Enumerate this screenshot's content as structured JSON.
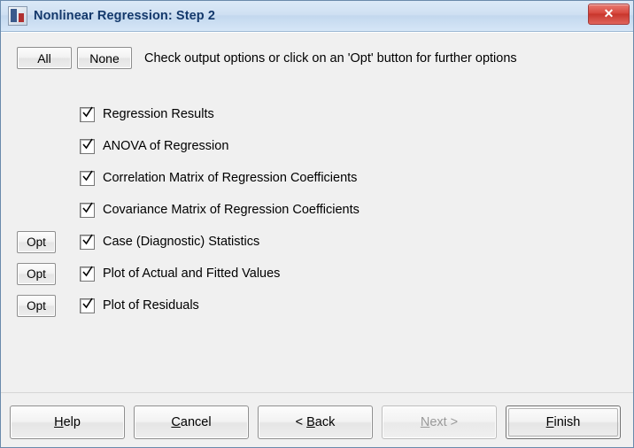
{
  "window": {
    "title": "Nonlinear Regression: Step 2",
    "app_icon": "regression-app-icon",
    "close_label": "✕"
  },
  "toolbar": {
    "all_label": "All",
    "none_label": "None",
    "instruction": "Check output options or click on an 'Opt' button for further options"
  },
  "options": [
    {
      "opt_button": "",
      "label": "Regression Results",
      "checked": true
    },
    {
      "opt_button": "",
      "label": "ANOVA of Regression",
      "checked": true
    },
    {
      "opt_button": "",
      "label": "Correlation Matrix of Regression Coefficients",
      "checked": true
    },
    {
      "opt_button": "",
      "label": "Covariance Matrix of Regression Coefficients",
      "checked": true
    },
    {
      "opt_button": "Opt",
      "label": "Case (Diagnostic) Statistics",
      "checked": true
    },
    {
      "opt_button": "Opt",
      "label": "Plot of Actual and Fitted Values",
      "checked": true
    },
    {
      "opt_button": "Opt",
      "label": "Plot of Residuals",
      "checked": true
    }
  ],
  "footer": {
    "help": "Help",
    "help_pre": "H",
    "help_post": "elp",
    "cancel_pre": "C",
    "cancel_post": "ancel",
    "back": "< Back",
    "back_pre": "< ",
    "back_mn": "B",
    "back_post": "ack",
    "next_pre": "",
    "next_mn": "N",
    "next_post": "ext >",
    "finish_pre": "",
    "finish_mn": "F",
    "finish_post": "inish"
  }
}
